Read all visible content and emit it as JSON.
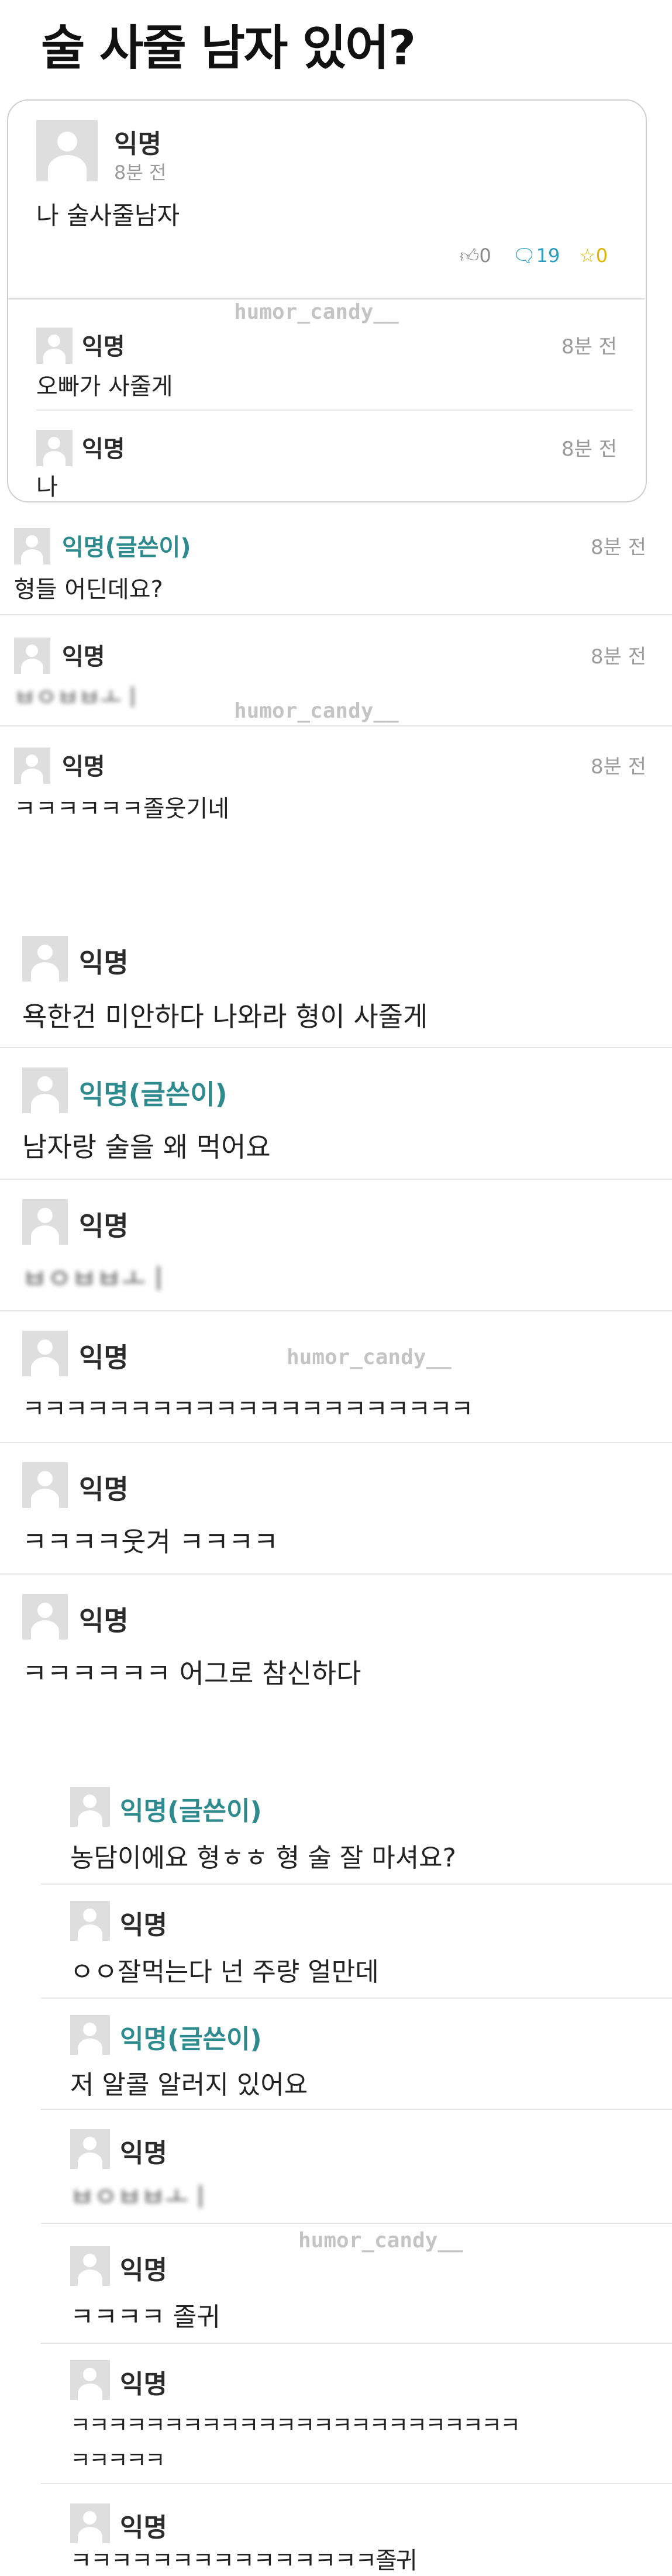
{
  "page": {
    "title": "술 사줄 남자 있어?"
  },
  "watermark": "humor_candy__",
  "post": {
    "nick": "익명",
    "time": "8분 전",
    "body": "나 술사줄남자",
    "likes": "0",
    "comments": "19",
    "scraps": "0",
    "colors": {
      "like": "#8a8a8a",
      "comment": "#2b9dbf",
      "scrap": "#e0b400"
    }
  },
  "card_comments": [
    {
      "nick": "익명",
      "time": "8분 전",
      "body": "오빠가 사줄게"
    },
    {
      "nick": "익명",
      "time": "8분 전",
      "body": "나"
    }
  ],
  "section2": [
    {
      "nick": "익명(글쓴이)",
      "time": "8분 전",
      "body": "형들 어딘데요?"
    },
    {
      "nick": "익명",
      "time": "8분 전",
      "body": "ㅂㅇㅂㅂㅗㅣ"
    },
    {
      "nick": "익명",
      "time": "8분 전",
      "body": "ㅋㅋㅋㅋㅋㅋ졸웃기네"
    }
  ],
  "section3": [
    {
      "nick": "익명",
      "body": "욕한건 미안하다 나와라 형이 사줄게"
    },
    {
      "nick": "익명(글쓴이)",
      "body": "남자랑 술을 왜 먹어요"
    },
    {
      "nick": "익명",
      "body": "ㅂㅇㅂㅂㅗㅣ"
    },
    {
      "nick": "익명",
      "body": "ㅋㅋㅋㅋㅋㅋㅋㅋㅋㅋㅋㅋㅋㅋㅋㅋㅋㅋㅋㅋㅋ"
    },
    {
      "nick": "익명",
      "body": "ㅋㅋㅋㅋ웃겨 ㅋㅋㅋㅋ"
    },
    {
      "nick": "익명",
      "body": "ㅋㅋㅋㅋㅋㅋ 어그로 참신하다"
    }
  ],
  "section4": [
    {
      "nick": "익명(글쓴이)",
      "body": "농담이에요 형ㅎㅎ 형 술 잘 마셔요?"
    },
    {
      "nick": "익명",
      "body": "ㅇㅇ잘먹는다 넌 주량 얼만데"
    },
    {
      "nick": "익명(글쓴이)",
      "body": "저 알콜 알러지 있어요"
    },
    {
      "nick": "익명",
      "body": "ㅂㅇㅂㅂㅗㅣ"
    },
    {
      "nick": "익명",
      "body": "ㅋㅋㅋㅋ 졸귀"
    },
    {
      "nick": "익명",
      "body": "ㅋㅋㅋㅋㅋㅋㅋㅋㅋㅋㅋㅋㅋㅋㅋㅋㅋㅋㅋㅋㅋㅋㅋㅋ",
      "body2": "ㅋㅋㅋㅋㅋ"
    },
    {
      "nick": "익명",
      "body": "ㅋㅋㅋㅋㅋㅋㅋㅋㅋㅋㅋㅋㅋㅋㅋ졸귀"
    }
  ]
}
